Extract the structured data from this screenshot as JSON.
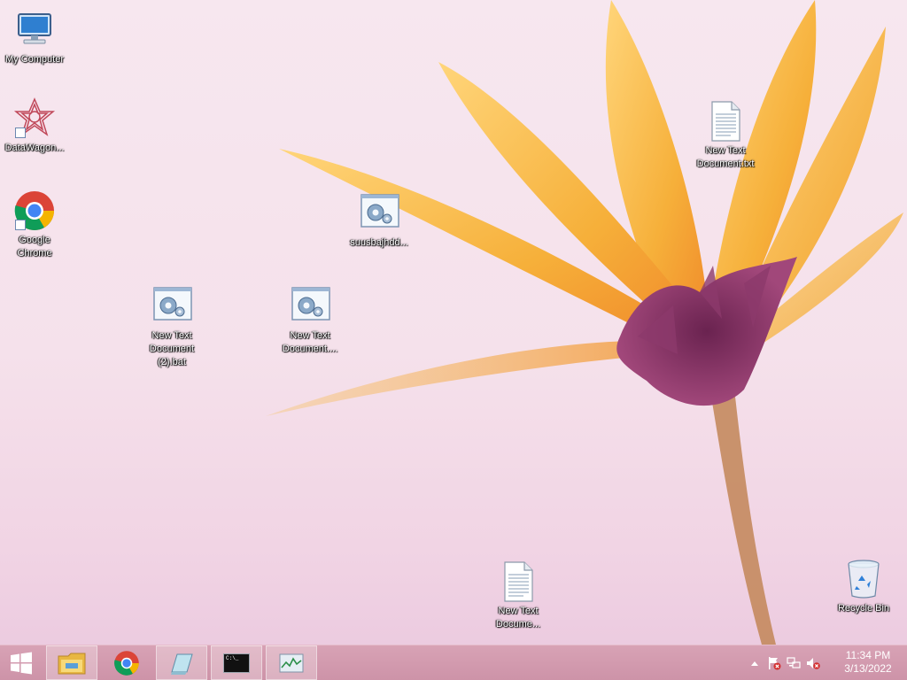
{
  "desktop": {
    "icons": [
      {
        "label": "My Computer",
        "icon": "computer-icon"
      },
      {
        "label": "DataWagon...",
        "icon": "datawagon-icon"
      },
      {
        "label": "Google Chrome",
        "icon": "chrome-icon"
      },
      {
        "label": "New Text Document (2).bat",
        "icon": "batch-file-icon"
      },
      {
        "label": "New Text Document....",
        "icon": "batch-file-icon"
      },
      {
        "label": "suusbajhdd...",
        "icon": "batch-file-icon"
      },
      {
        "label": "New Text Document.txt",
        "icon": "text-file-icon"
      },
      {
        "label": "New Text Docume...",
        "icon": "text-file-icon"
      },
      {
        "label": "Recycle Bin",
        "icon": "recycle-bin-icon"
      }
    ]
  },
  "taskbar": {
    "start": {
      "icon": "windows-logo-icon"
    },
    "pinned": [
      {
        "icon": "file-explorer-icon",
        "active": true
      },
      {
        "icon": "chrome-icon",
        "active": false
      },
      {
        "icon": "notepad-icon",
        "active": true
      },
      {
        "icon": "command-prompt-icon",
        "active": true
      },
      {
        "icon": "task-manager-icon",
        "active": true
      }
    ],
    "cmd_prompt_text": "C:\\_",
    "tray": {
      "icons": [
        "show-hidden-icons-arrow",
        "action-center-flag-icon",
        "network-icon",
        "volume-muted-icon"
      ],
      "time": "11:34 PM",
      "date": "3/13/2022"
    }
  }
}
